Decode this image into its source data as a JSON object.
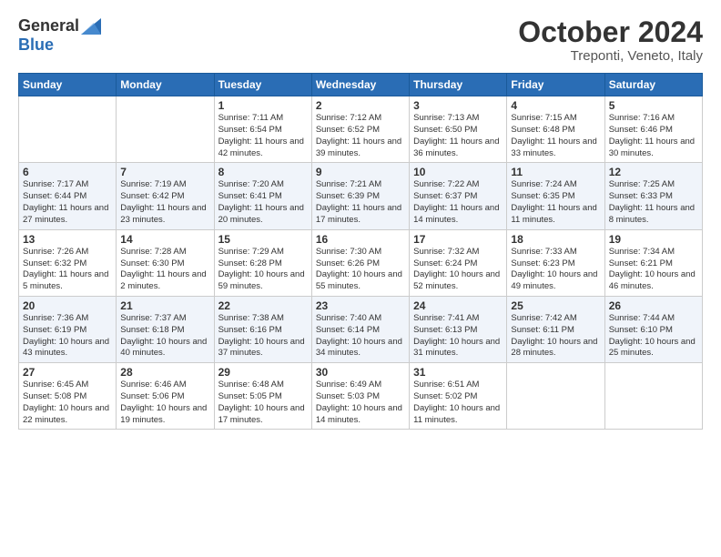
{
  "header": {
    "logo": {
      "general": "General",
      "blue": "Blue"
    },
    "title": "October 2024",
    "location": "Treponti, Veneto, Italy"
  },
  "columns": [
    "Sunday",
    "Monday",
    "Tuesday",
    "Wednesday",
    "Thursday",
    "Friday",
    "Saturday"
  ],
  "weeks": [
    {
      "days": [
        {
          "num": "",
          "info": ""
        },
        {
          "num": "",
          "info": ""
        },
        {
          "num": "1",
          "info": "Sunrise: 7:11 AM\nSunset: 6:54 PM\nDaylight: 11 hours and 42 minutes."
        },
        {
          "num": "2",
          "info": "Sunrise: 7:12 AM\nSunset: 6:52 PM\nDaylight: 11 hours and 39 minutes."
        },
        {
          "num": "3",
          "info": "Sunrise: 7:13 AM\nSunset: 6:50 PM\nDaylight: 11 hours and 36 minutes."
        },
        {
          "num": "4",
          "info": "Sunrise: 7:15 AM\nSunset: 6:48 PM\nDaylight: 11 hours and 33 minutes."
        },
        {
          "num": "5",
          "info": "Sunrise: 7:16 AM\nSunset: 6:46 PM\nDaylight: 11 hours and 30 minutes."
        }
      ]
    },
    {
      "days": [
        {
          "num": "6",
          "info": "Sunrise: 7:17 AM\nSunset: 6:44 PM\nDaylight: 11 hours and 27 minutes."
        },
        {
          "num": "7",
          "info": "Sunrise: 7:19 AM\nSunset: 6:42 PM\nDaylight: 11 hours and 23 minutes."
        },
        {
          "num": "8",
          "info": "Sunrise: 7:20 AM\nSunset: 6:41 PM\nDaylight: 11 hours and 20 minutes."
        },
        {
          "num": "9",
          "info": "Sunrise: 7:21 AM\nSunset: 6:39 PM\nDaylight: 11 hours and 17 minutes."
        },
        {
          "num": "10",
          "info": "Sunrise: 7:22 AM\nSunset: 6:37 PM\nDaylight: 11 hours and 14 minutes."
        },
        {
          "num": "11",
          "info": "Sunrise: 7:24 AM\nSunset: 6:35 PM\nDaylight: 11 hours and 11 minutes."
        },
        {
          "num": "12",
          "info": "Sunrise: 7:25 AM\nSunset: 6:33 PM\nDaylight: 11 hours and 8 minutes."
        }
      ]
    },
    {
      "days": [
        {
          "num": "13",
          "info": "Sunrise: 7:26 AM\nSunset: 6:32 PM\nDaylight: 11 hours and 5 minutes."
        },
        {
          "num": "14",
          "info": "Sunrise: 7:28 AM\nSunset: 6:30 PM\nDaylight: 11 hours and 2 minutes."
        },
        {
          "num": "15",
          "info": "Sunrise: 7:29 AM\nSunset: 6:28 PM\nDaylight: 10 hours and 59 minutes."
        },
        {
          "num": "16",
          "info": "Sunrise: 7:30 AM\nSunset: 6:26 PM\nDaylight: 10 hours and 55 minutes."
        },
        {
          "num": "17",
          "info": "Sunrise: 7:32 AM\nSunset: 6:24 PM\nDaylight: 10 hours and 52 minutes."
        },
        {
          "num": "18",
          "info": "Sunrise: 7:33 AM\nSunset: 6:23 PM\nDaylight: 10 hours and 49 minutes."
        },
        {
          "num": "19",
          "info": "Sunrise: 7:34 AM\nSunset: 6:21 PM\nDaylight: 10 hours and 46 minutes."
        }
      ]
    },
    {
      "days": [
        {
          "num": "20",
          "info": "Sunrise: 7:36 AM\nSunset: 6:19 PM\nDaylight: 10 hours and 43 minutes."
        },
        {
          "num": "21",
          "info": "Sunrise: 7:37 AM\nSunset: 6:18 PM\nDaylight: 10 hours and 40 minutes."
        },
        {
          "num": "22",
          "info": "Sunrise: 7:38 AM\nSunset: 6:16 PM\nDaylight: 10 hours and 37 minutes."
        },
        {
          "num": "23",
          "info": "Sunrise: 7:40 AM\nSunset: 6:14 PM\nDaylight: 10 hours and 34 minutes."
        },
        {
          "num": "24",
          "info": "Sunrise: 7:41 AM\nSunset: 6:13 PM\nDaylight: 10 hours and 31 minutes."
        },
        {
          "num": "25",
          "info": "Sunrise: 7:42 AM\nSunset: 6:11 PM\nDaylight: 10 hours and 28 minutes."
        },
        {
          "num": "26",
          "info": "Sunrise: 7:44 AM\nSunset: 6:10 PM\nDaylight: 10 hours and 25 minutes."
        }
      ]
    },
    {
      "days": [
        {
          "num": "27",
          "info": "Sunrise: 6:45 AM\nSunset: 5:08 PM\nDaylight: 10 hours and 22 minutes."
        },
        {
          "num": "28",
          "info": "Sunrise: 6:46 AM\nSunset: 5:06 PM\nDaylight: 10 hours and 19 minutes."
        },
        {
          "num": "29",
          "info": "Sunrise: 6:48 AM\nSunset: 5:05 PM\nDaylight: 10 hours and 17 minutes."
        },
        {
          "num": "30",
          "info": "Sunrise: 6:49 AM\nSunset: 5:03 PM\nDaylight: 10 hours and 14 minutes."
        },
        {
          "num": "31",
          "info": "Sunrise: 6:51 AM\nSunset: 5:02 PM\nDaylight: 10 hours and 11 minutes."
        },
        {
          "num": "",
          "info": ""
        },
        {
          "num": "",
          "info": ""
        }
      ]
    }
  ]
}
